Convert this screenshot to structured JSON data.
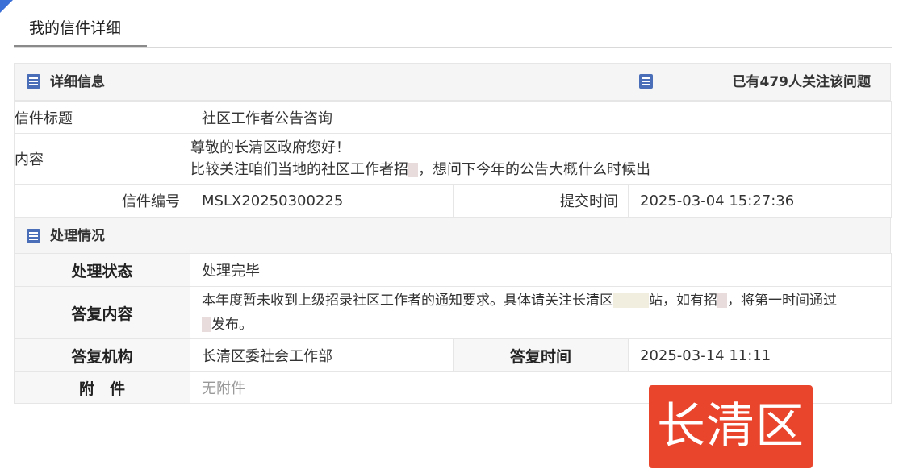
{
  "tab": {
    "label": "我的信件详细"
  },
  "detail_section": {
    "title": "详细信息",
    "followers": "已有479人关注该问题"
  },
  "letter": {
    "subject_label": "信件标题",
    "subject": "社区工作者公告咨询",
    "content_label": "内容",
    "content_line1": "尊敬的长清区政府您好！",
    "content_line2_a": "比较关注咱们当地的社区工作者招",
    "content_line2_b": "，想问下今年的公告大概什么时候出",
    "number_label": "信件编号",
    "number": "MSLX20250300225",
    "submit_label": "提交时间",
    "submit_time": "2025-03-04 15:27:36"
  },
  "process_section": {
    "title": "处理情况"
  },
  "process": {
    "status_label": "处理状态",
    "status": "处理完毕",
    "reply_label": "答复内容",
    "reply_line1_a": "本年度暂未收到上级招录社区工作者的通知要求。具体请关注长清区",
    "reply_line1_b": "站，如有招",
    "reply_line1_c": "，将第一时间通过",
    "reply_line2": "发布。",
    "org_label": "答复机构",
    "org": "长清区委社会工作部",
    "reply_time_label": "答复时间",
    "reply_time": "2025-03-14 11:11",
    "attach_label": "附　件",
    "attach": "无附件"
  },
  "watermark": {
    "text": "长清区"
  }
}
